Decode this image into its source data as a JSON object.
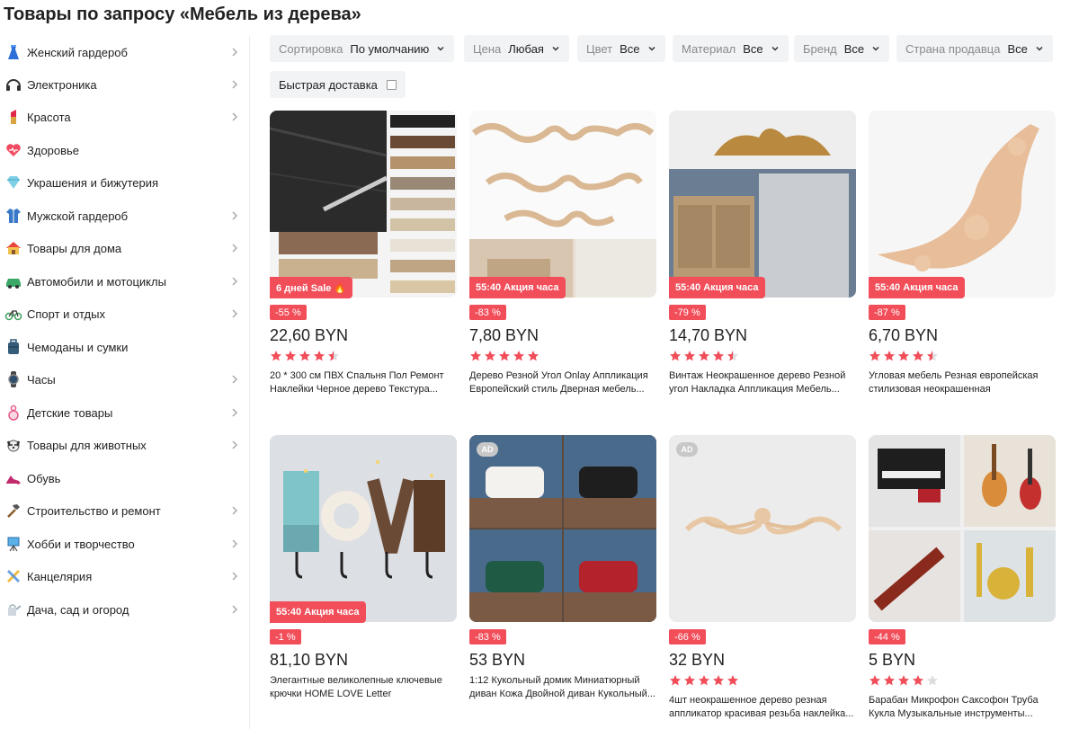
{
  "page": {
    "title": "Товары по запросу «Мебель из дерева»"
  },
  "sidebar": {
    "items": [
      {
        "label": "Женский гардероб",
        "icon": "dress-icon",
        "arrow": true
      },
      {
        "label": "Электроника",
        "icon": "headphones-icon",
        "arrow": true
      },
      {
        "label": "Красота",
        "icon": "lipstick-icon",
        "arrow": true
      },
      {
        "label": "Здоровье",
        "icon": "heart-icon",
        "arrow": false
      },
      {
        "label": "Украшения и бижутерия",
        "icon": "diamond-icon",
        "arrow": false
      },
      {
        "label": "Мужской гардероб",
        "icon": "shirt-icon",
        "arrow": true
      },
      {
        "label": "Товары для дома",
        "icon": "house-icon",
        "arrow": true
      },
      {
        "label": "Автомобили и мотоциклы",
        "icon": "car-icon",
        "arrow": true
      },
      {
        "label": "Спорт и отдых",
        "icon": "bicycle-icon",
        "arrow": true
      },
      {
        "label": "Чемоданы и сумки",
        "icon": "suitcase-icon",
        "arrow": false
      },
      {
        "label": "Часы",
        "icon": "watch-icon",
        "arrow": true
      },
      {
        "label": "Детские товары",
        "icon": "pacifier-icon",
        "arrow": true
      },
      {
        "label": "Товары для животных",
        "icon": "dog-icon",
        "arrow": true
      },
      {
        "label": "Обувь",
        "icon": "shoe-icon",
        "arrow": false
      },
      {
        "label": "Строительство и ремонт",
        "icon": "hammer-icon",
        "arrow": true
      },
      {
        "label": "Хобби и творчество",
        "icon": "easel-icon",
        "arrow": true
      },
      {
        "label": "Канцелярия",
        "icon": "pencils-icon",
        "arrow": true
      },
      {
        "label": "Дача, сад и огород",
        "icon": "watering-can-icon",
        "arrow": true
      }
    ]
  },
  "filters": {
    "sort": {
      "label": "Сортировка",
      "value": "По умолчанию"
    },
    "price": {
      "label": "Цена",
      "value": "Любая"
    },
    "color": {
      "label": "Цвет",
      "value": "Все"
    },
    "material": {
      "label": "Материал",
      "value": "Все"
    },
    "brand": {
      "label": "Бренд",
      "value": "Все"
    },
    "country": {
      "label": "Страна продавца",
      "value": "Все"
    },
    "fast_delivery": {
      "label": "Быстрая доставка",
      "checked": false
    }
  },
  "products": [
    {
      "promo": "6 дней  Sale 🔥",
      "discount": "-55 %",
      "price": "22,60 BYN",
      "rating": 4.5,
      "title": "20 * 300 см ПВХ Спальня Пол Ремонт Наклейки Черное дерево Текстура...",
      "ad": false,
      "image": "wood-floor-stickers"
    },
    {
      "promo": "55:40  Акция часа",
      "discount": "-83 %",
      "price": "7,80 BYN",
      "rating": 5,
      "title": "Дерево Резной Угол Onlay Аппликация Европейский стиль Дверная мебель...",
      "ad": false,
      "image": "carved-onlays"
    },
    {
      "promo": "55:40  Акция часа",
      "discount": "-79 %",
      "price": "14,70 BYN",
      "rating": 4.5,
      "title": "Винтаж Неокрашенное дерево Резной угол Накладка Аппликация Мебель...",
      "ad": false,
      "image": "vintage-applique"
    },
    {
      "promo": "55:40  Акция часа",
      "discount": "-87 %",
      "price": "6,70 BYN",
      "rating": 4.5,
      "title": "Угловая мебель Резная европейская стилизовая неокрашенная деревянная...",
      "ad": false,
      "image": "corner-carving"
    },
    {
      "promo": "55:40  Акция часа",
      "discount": "-1 %",
      "price": "81,10 BYN",
      "rating": null,
      "title": "Элегантные великолепные ключевые крючки HOME LOVE Letter Деревянные...",
      "ad": false,
      "image": "love-hooks"
    },
    {
      "promo": "",
      "discount": "-83 %",
      "price": "53 BYN",
      "rating": null,
      "title": "1:12 Кукольный домик Миниатюрный диван Кожа Двойной диван Кукольный...",
      "ad": true,
      "ad_label": "AD",
      "image": "doll-sofas"
    },
    {
      "promo": "",
      "discount": "-66 %",
      "price": "32 BYN",
      "rating": 5,
      "title": "4шт неокрашенное дерево резная аппликатор красивая резьба наклейка...",
      "ad": true,
      "ad_label": "AD",
      "image": "carving-on-white"
    },
    {
      "promo": "",
      "discount": "-44 %",
      "price": "5 BYN",
      "rating": 4,
      "title": "Барабан Микрофон Саксофон Труба Кукла Музыкальные инструменты...",
      "ad": false,
      "image": "mini-instruments"
    }
  ],
  "colors": {
    "accent": "#f14e5a",
    "filter_bg": "#f2f3f5",
    "star": "#f14e5a",
    "star_empty": "#dddddd"
  }
}
